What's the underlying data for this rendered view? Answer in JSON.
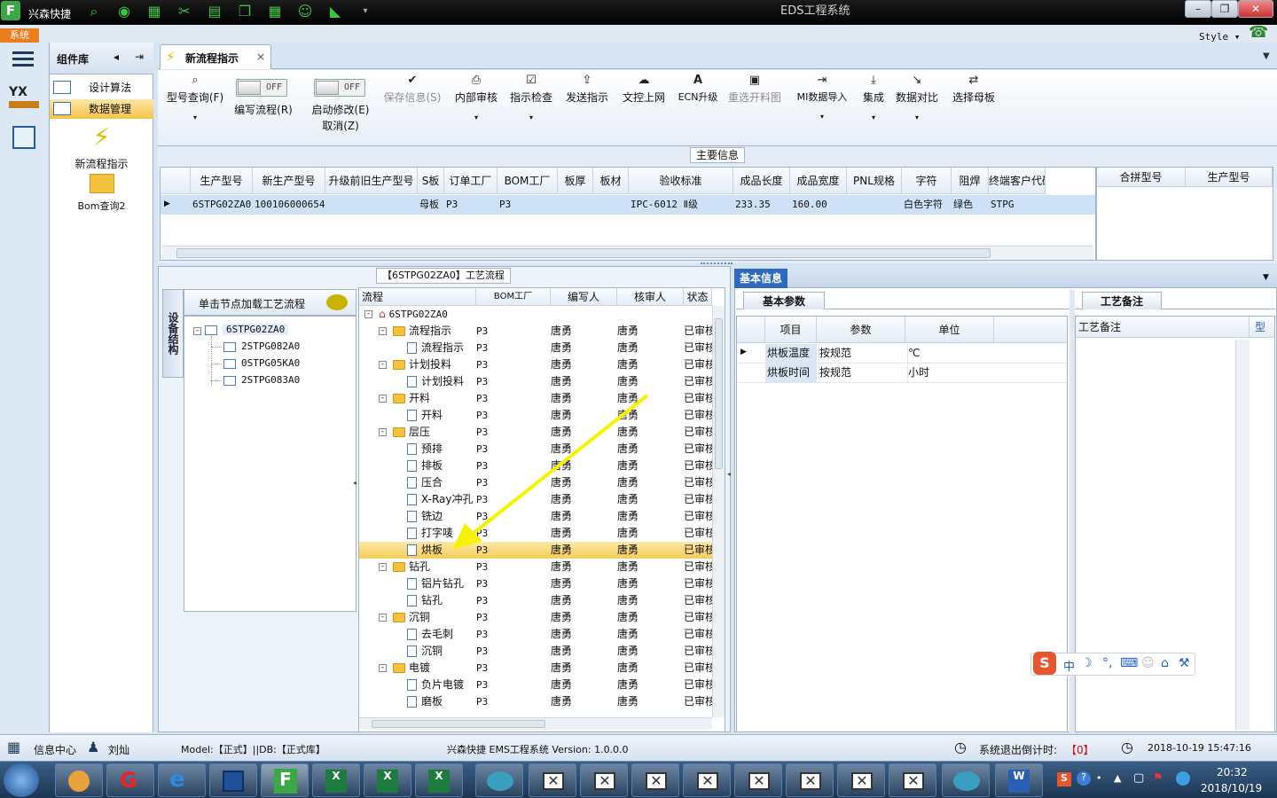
{
  "app": {
    "name": "兴森快捷",
    "window_title": "EDS工程系统",
    "logo_letter": "F",
    "menu_tab": "系统",
    "style_label": "Style"
  },
  "complib": {
    "title": "组件库",
    "items": [
      {
        "label": "设计算法"
      },
      {
        "label": "数据管理"
      }
    ],
    "tiles": [
      {
        "label": "新流程指示"
      },
      {
        "label": "Bom查询2"
      }
    ]
  },
  "tab": {
    "label": "新流程指示"
  },
  "ribbon": {
    "model_query": "型号查询(F)",
    "toggle_off": "OFF",
    "write_flow": "编写流程(R)",
    "enable_edit": "启动修改(E)",
    "cancel": "取消(Z)",
    "save_info": "保存信息(S)",
    "internal_review": "内部审核",
    "instr_check": "指示检查",
    "send_instr": "发送指示",
    "upload": "文控上网",
    "ecn": "ECN升级",
    "reselect": "重选开料图",
    "mi_import": "MI数据导入",
    "integrate": "集成",
    "compare": "数据对比",
    "select_mother": "选择母板"
  },
  "main_info": {
    "title": "主要信息",
    "columns": [
      "生产型号",
      "新生产型号",
      "升级前旧生产型号",
      "S板",
      "订单工厂",
      "BOM工厂",
      "板厚",
      "板材",
      "验收标准",
      "成品长度",
      "成品宽度",
      "PNL规格",
      "字符",
      "阻焊",
      "终端客户代码"
    ],
    "row": [
      "6STPG02ZA0",
      "10010600065414",
      "",
      "母板",
      "P3",
      "P3",
      "",
      "",
      "IPC-6012 Ⅱ级",
      "233.35",
      "160.00",
      "",
      "白色字符",
      "绿色",
      "STPG"
    ],
    "side_columns": [
      "合拼型号",
      "生产型号"
    ]
  },
  "flow_panel": {
    "title": "【6STPG02ZA0】工艺流程",
    "side_tab": "设备结构",
    "load_hint": "单击节点加载工艺流程",
    "tree": {
      "root": "6STPG02ZA0",
      "children": [
        "2STPG082A0",
        "0STPG05KA0",
        "2STPG083A0"
      ]
    },
    "columns": [
      "流程",
      "BOM工厂",
      "编写人",
      "核审人",
      "状态"
    ],
    "rows": [
      {
        "name": "6STPG02ZA0",
        "level": 0,
        "kind": "root",
        "bom": "",
        "writer": "",
        "reviewer": "",
        "status": ""
      },
      {
        "name": "流程指示",
        "level": 1,
        "kind": "folder",
        "bom": "P3",
        "writer": "唐勇",
        "reviewer": "唐勇",
        "status": "已审核"
      },
      {
        "name": "流程指示",
        "level": 2,
        "kind": "doc",
        "bom": "P3",
        "writer": "唐勇",
        "reviewer": "唐勇",
        "status": "已审核"
      },
      {
        "name": "计划投料",
        "level": 1,
        "kind": "folder",
        "bom": "P3",
        "writer": "唐勇",
        "reviewer": "唐勇",
        "status": "已审核"
      },
      {
        "name": "计划投料",
        "level": 2,
        "kind": "doc",
        "bom": "P3",
        "writer": "唐勇",
        "reviewer": "唐勇",
        "status": "已审核"
      },
      {
        "name": "开料",
        "level": 1,
        "kind": "folder",
        "bom": "P3",
        "writer": "唐勇",
        "reviewer": "唐勇",
        "status": "已审核"
      },
      {
        "name": "开料",
        "level": 2,
        "kind": "doc",
        "bom": "P3",
        "writer": "唐勇",
        "reviewer": "唐勇",
        "status": "已审核"
      },
      {
        "name": "层压",
        "level": 1,
        "kind": "folder",
        "bom": "P3",
        "writer": "唐勇",
        "reviewer": "唐勇",
        "status": "已审核"
      },
      {
        "name": "预排",
        "level": 2,
        "kind": "doc",
        "bom": "P3",
        "writer": "唐勇",
        "reviewer": "唐勇",
        "status": "已审核"
      },
      {
        "name": "排板",
        "level": 2,
        "kind": "doc",
        "bom": "P3",
        "writer": "唐勇",
        "reviewer": "唐勇",
        "status": "已审核"
      },
      {
        "name": "压合",
        "level": 2,
        "kind": "doc",
        "bom": "P3",
        "writer": "唐勇",
        "reviewer": "唐勇",
        "status": "已审核"
      },
      {
        "name": "X-Ray冲孔",
        "level": 2,
        "kind": "doc",
        "bom": "P3",
        "writer": "唐勇",
        "reviewer": "唐勇",
        "status": "已审核"
      },
      {
        "name": "铣边",
        "level": 2,
        "kind": "doc",
        "bom": "P3",
        "writer": "唐勇",
        "reviewer": "唐勇",
        "status": "已审核"
      },
      {
        "name": "打字唛",
        "level": 2,
        "kind": "doc",
        "bom": "P3",
        "writer": "唐勇",
        "reviewer": "唐勇",
        "status": "已审核"
      },
      {
        "name": "烘板",
        "level": 2,
        "kind": "doc",
        "bom": "P3",
        "writer": "唐勇",
        "reviewer": "唐勇",
        "status": "已审核",
        "selected": true
      },
      {
        "name": "钻孔",
        "level": 1,
        "kind": "folder",
        "bom": "P3",
        "writer": "唐勇",
        "reviewer": "唐勇",
        "status": "已审核"
      },
      {
        "name": "铝片钻孔",
        "level": 2,
        "kind": "doc",
        "bom": "P3",
        "writer": "唐勇",
        "reviewer": "唐勇",
        "status": "已审核"
      },
      {
        "name": "钻孔",
        "level": 2,
        "kind": "doc",
        "bom": "P3",
        "writer": "唐勇",
        "reviewer": "唐勇",
        "status": "已审核"
      },
      {
        "name": "沉铜",
        "level": 1,
        "kind": "folder",
        "bom": "P3",
        "writer": "唐勇",
        "reviewer": "唐勇",
        "status": "已审核"
      },
      {
        "name": "去毛刺",
        "level": 2,
        "kind": "doc",
        "bom": "P3",
        "writer": "唐勇",
        "reviewer": "唐勇",
        "status": "已审核"
      },
      {
        "name": "沉铜",
        "level": 2,
        "kind": "doc",
        "bom": "P3",
        "writer": "唐勇",
        "reviewer": "唐勇",
        "status": "已审核"
      },
      {
        "name": "电镀",
        "level": 1,
        "kind": "folder",
        "bom": "P3",
        "writer": "唐勇",
        "reviewer": "唐勇",
        "status": "已审核"
      },
      {
        "name": "负片电镀",
        "level": 2,
        "kind": "doc",
        "bom": "P3",
        "writer": "唐勇",
        "reviewer": "唐勇",
        "status": "已审核"
      },
      {
        "name": "磨板",
        "level": 2,
        "kind": "doc",
        "bom": "P3",
        "writer": "唐勇",
        "reviewer": "唐勇",
        "status": "已审核"
      }
    ]
  },
  "basic_info": {
    "title": "基本信息",
    "subtab": "基本参数",
    "columns": [
      "项目",
      "参数",
      "单位"
    ],
    "rows": [
      {
        "item": "烘板温度",
        "param": "按规范",
        "unit": "℃"
      },
      {
        "item": "烘板时间",
        "param": "按规范",
        "unit": "小时"
      }
    ]
  },
  "process_note": {
    "tab": "工艺备注",
    "column": "工艺备注",
    "column2": "型"
  },
  "status": {
    "info_center": "信息中心",
    "user": "刘灿",
    "model_db": "Model:【正式】||DB:【正式库】",
    "version": "兴森快捷 EMS工程系统 Version: 1.0.0.0",
    "countdown_label": "系统退出倒计时:",
    "countdown_value": "【0】",
    "datetime": "2018-10-19 15:47:16"
  },
  "taskbar": {
    "time": "20:32",
    "date": "2018/10/19"
  },
  "ime": {
    "lang": "中"
  }
}
